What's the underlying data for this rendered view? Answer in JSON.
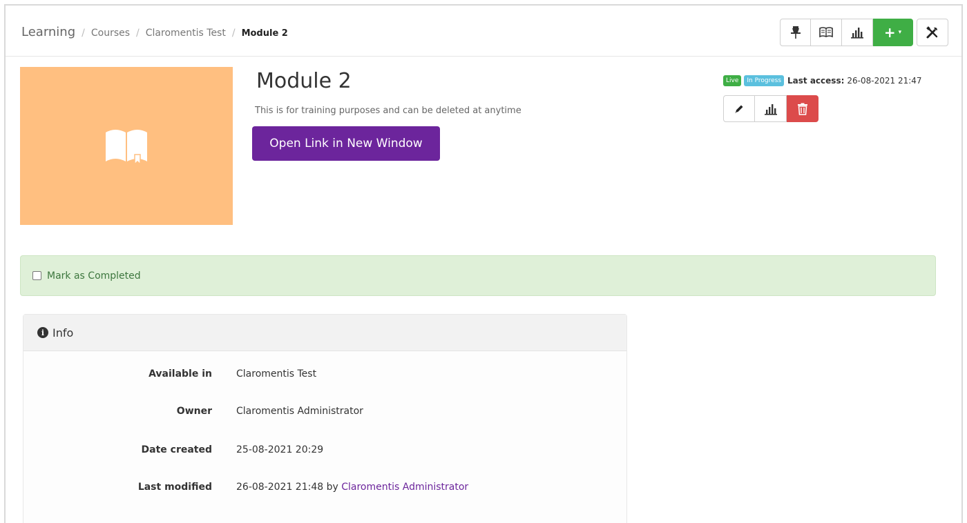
{
  "breadcrumb": {
    "root": "Learning",
    "items": [
      "Courses",
      "Claromentis Test"
    ],
    "current": "Module 2",
    "separator": "/"
  },
  "toolbar": {
    "buttons": [
      {
        "icon": "pin-icon"
      },
      {
        "icon": "book-icon"
      },
      {
        "icon": "bar-chart-icon"
      },
      {
        "icon": "plus-icon",
        "label": "+",
        "caret": "▾"
      },
      {
        "icon": "tools-icon"
      }
    ],
    "accent": "#3fae45"
  },
  "thumbnail": {
    "icon": "open-book-icon",
    "color": "#ffbf80"
  },
  "module": {
    "title": "Module 2",
    "description": "This is for training purposes and can be deleted at anytime",
    "open_button": "Open Link in New Window",
    "button_color": "#6c259c"
  },
  "status": {
    "badges": [
      {
        "label": "Live",
        "color": "#3fae45"
      },
      {
        "label": "In Progress",
        "color": "#5bc0de"
      }
    ],
    "last_access_label": "Last access:",
    "last_access_value": "26-08-2021 21:47"
  },
  "actions": [
    {
      "icon": "pencil-icon"
    },
    {
      "icon": "bar-chart-icon"
    },
    {
      "icon": "trash-icon",
      "color": "#dc4b4b"
    }
  ],
  "completion": {
    "label": "Mark as Completed",
    "checked": false
  },
  "info": {
    "heading": "Info",
    "rows": [
      {
        "key": "Available in",
        "value": "Claromentis Test"
      },
      {
        "key": "Owner",
        "value": "Claromentis Administrator"
      },
      {
        "key": "Date created",
        "value": "25-08-2021 20:29"
      },
      {
        "key": "Last modified",
        "value": "26-08-2021 21:48 by",
        "link": "Claromentis Administrator"
      }
    ]
  }
}
